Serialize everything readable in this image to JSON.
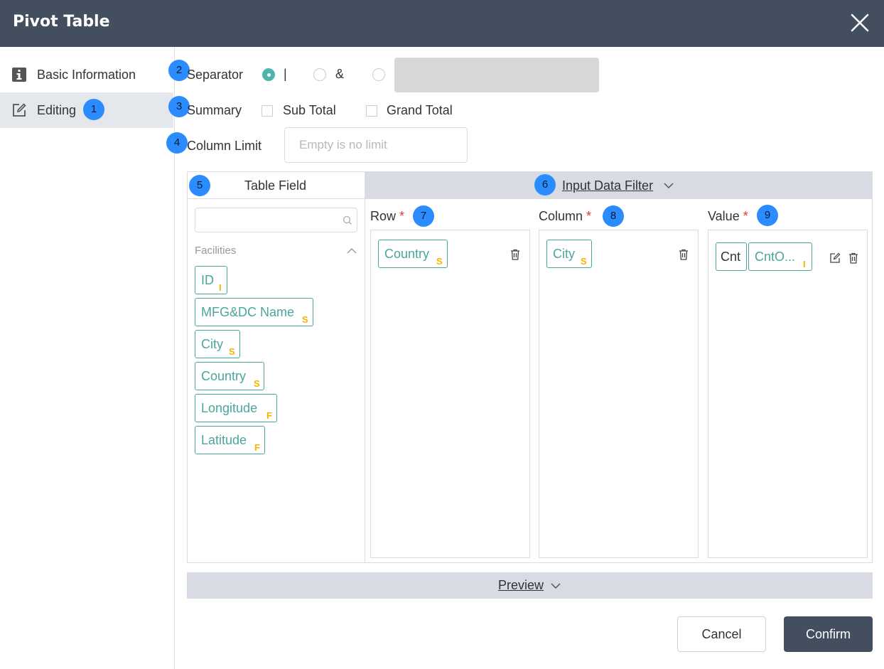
{
  "dialog": {
    "title": "Pivot Table"
  },
  "sidebar": {
    "items": [
      {
        "label": "Basic Information",
        "icon": "info-icon",
        "active": false
      },
      {
        "label": "Editing",
        "icon": "edit-icon",
        "active": true,
        "badge": "1"
      }
    ]
  },
  "form": {
    "separator": {
      "label": "Separator",
      "badge": "2",
      "options": [
        "|",
        "&",
        ""
      ],
      "selected": "|"
    },
    "summary": {
      "label": "Summary",
      "badge": "3",
      "options": [
        {
          "label": "Sub Total",
          "checked": false
        },
        {
          "label": "Grand Total",
          "checked": false
        }
      ]
    },
    "column_limit": {
      "label": "Column Limit",
      "badge": "4",
      "value": "",
      "placeholder": "Empty is no limit"
    }
  },
  "table_field": {
    "title": "Table Field",
    "badge": "5",
    "search_value": "",
    "group": "Facilities",
    "fields": [
      {
        "name": "ID",
        "type": "I"
      },
      {
        "name": "MFG&DC Name",
        "type": "S"
      },
      {
        "name": "City",
        "type": "S"
      },
      {
        "name": "Country",
        "type": "S"
      },
      {
        "name": "Longitude",
        "type": "F"
      },
      {
        "name": "Latitude",
        "type": "F"
      }
    ]
  },
  "input_filter": {
    "label": "Input Data Filter",
    "badge": "6"
  },
  "zones": {
    "row": {
      "label": "Row",
      "required": "*",
      "badge": "7",
      "fields": [
        {
          "name": "Country",
          "type": "S"
        }
      ]
    },
    "column": {
      "label": "Column",
      "required": "*",
      "badge": "8",
      "fields": [
        {
          "name": "City",
          "type": "S"
        }
      ]
    },
    "value": {
      "label": "Value",
      "required": "*",
      "badge": "9",
      "aggregate": "Cnt",
      "fields": [
        {
          "name": "CntO...",
          "type": "I"
        }
      ]
    }
  },
  "preview": {
    "label": "Preview"
  },
  "buttons": {
    "cancel": "Cancel",
    "confirm": "Confirm"
  },
  "colors": {
    "header": "#434f5e",
    "accent": "#4aa69c",
    "type_tag": "#f5b400",
    "badge": "#2b8cff",
    "bar": "#d8dbe4"
  }
}
